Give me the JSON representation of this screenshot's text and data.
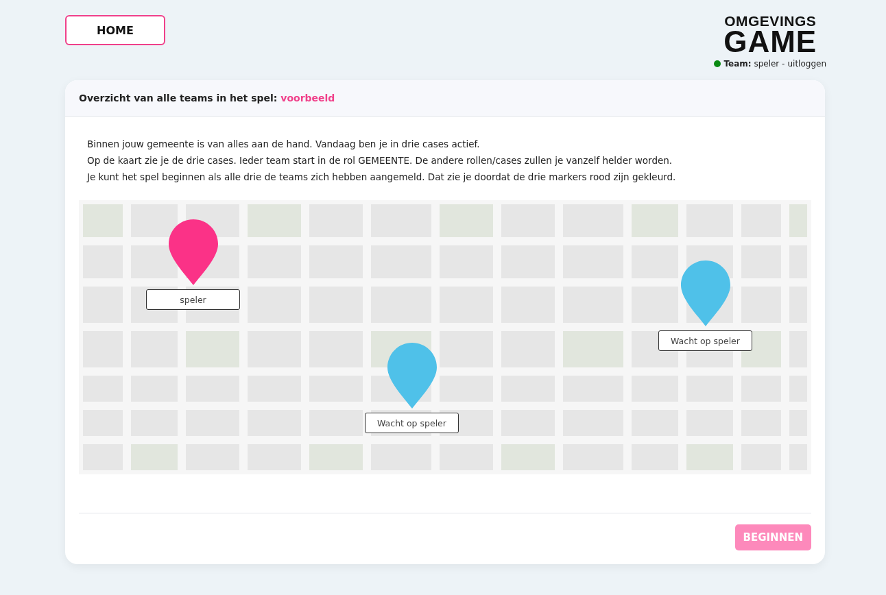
{
  "home_button": {
    "label": "HOME"
  },
  "logo": {
    "line_1": "OMGEVINGS",
    "line_2": "GAME"
  },
  "team_status": {
    "online": true,
    "label": "Team:",
    "name": "speler",
    "separator": "-",
    "logout_link": "uitloggen"
  },
  "card": {
    "header_text": "Overzicht van alle teams in het spel:",
    "game_name": "voorbeeld",
    "intro_lines": [
      "Binnen jouw gemeente is van alles aan de hand. Vandaag ben je in drie cases actief.",
      "Op de kaart zie je de drie cases. Ieder team start in de rol GEMEENTE. De andere rollen/cases zullen je vanzelf helder worden.",
      "Je kunt het spel beginnen als alle drie de teams zich hebben aangemeld. Dat zie je doordat de drie markers rood zijn gekleurd."
    ],
    "markers": [
      {
        "label": "speler",
        "joined": true
      },
      {
        "label": "Wacht op speler",
        "joined": false
      },
      {
        "label": "Wacht op speler",
        "joined": false
      }
    ],
    "start_button": {
      "label": "BEGINNEN",
      "disabled": true
    }
  }
}
